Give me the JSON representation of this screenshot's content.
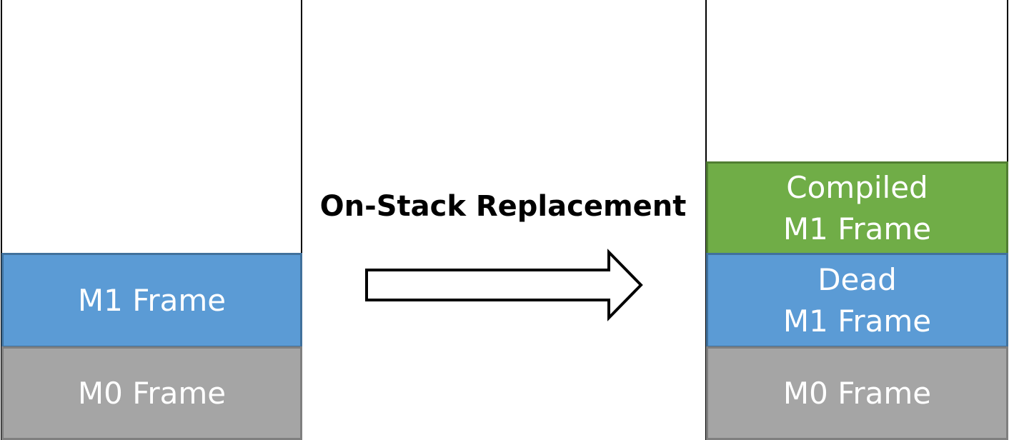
{
  "title": "On-Stack Replacement",
  "left_stack": {
    "m1": "M1 Frame",
    "m0": "M0 Frame"
  },
  "right_stack": {
    "compiled_line1": "Compiled",
    "compiled_line2": "M1 Frame",
    "dead_line1": "Dead",
    "dead_line2": "M1 Frame",
    "m0": "M0 Frame"
  },
  "colors": {
    "blue": "#5B9BD5",
    "gray": "#A5A5A5",
    "green": "#70AD47"
  }
}
